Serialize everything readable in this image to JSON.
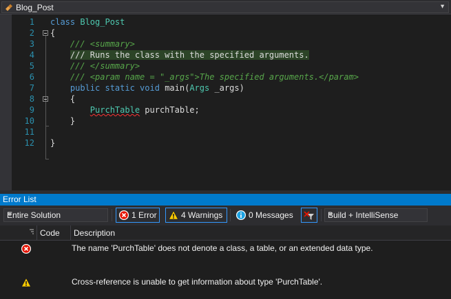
{
  "navbar": {
    "type_name": "Blog_Post"
  },
  "editor": {
    "line_numbers": [
      "1",
      "2",
      "3",
      "4",
      "5",
      "6",
      "7",
      "8",
      "9",
      "10",
      "11",
      "12"
    ],
    "lines": [
      [
        {
          "t": "class ",
          "c": "kw"
        },
        {
          "t": "Blog_Post",
          "c": "ty"
        }
      ],
      [
        {
          "t": "{",
          "c": ""
        }
      ],
      [
        {
          "t": "    /// <summary>",
          "c": "cm"
        }
      ],
      [
        {
          "t": "    ",
          "c": ""
        },
        {
          "t": "/// Runs the class with the specified arguments.",
          "c": "cm-hl"
        }
      ],
      [
        {
          "t": "    /// </summary>",
          "c": "cm"
        }
      ],
      [
        {
          "t": "    /// <param name = \"_args\">The specified arguments.</param>",
          "c": "cm"
        }
      ],
      [
        {
          "t": "    ",
          "c": ""
        },
        {
          "t": "public static void ",
          "c": "kw"
        },
        {
          "t": "main(",
          "c": ""
        },
        {
          "t": "Args",
          "c": "ty"
        },
        {
          "t": " _args)",
          "c": ""
        }
      ],
      [
        {
          "t": "    {",
          "c": ""
        }
      ],
      [
        {
          "t": "        ",
          "c": ""
        },
        {
          "t": "PurchTable",
          "c": "ty-err"
        },
        {
          "t": " purchTable;",
          "c": ""
        }
      ],
      [
        {
          "t": "    }",
          "c": ""
        }
      ],
      [
        {
          "t": "",
          "c": ""
        }
      ],
      [
        {
          "t": "}",
          "c": ""
        }
      ]
    ]
  },
  "error_list": {
    "title": "Error List",
    "scope": "Entire Solution",
    "errors_label": "1 Error",
    "warnings_label": "4 Warnings",
    "messages_label": "0 Messages",
    "source": "Build + IntelliSense",
    "columns": {
      "code": "Code",
      "description": "Description"
    },
    "rows": [
      {
        "kind": "error-icon",
        "description": "The name 'PurchTable' does not denote a class, a table, or an extended data type."
      },
      {
        "kind": "warning-icon",
        "description": "Cross-reference is unable to get information about type 'PurchTable'."
      }
    ]
  },
  "colors": {
    "accent": "#007acc",
    "keyword": "#569cd6",
    "type": "#4ec9b0",
    "comment": "#57a64a",
    "line_number": "#2b91af",
    "error": "#e51400",
    "warning": "#ffcc00"
  }
}
